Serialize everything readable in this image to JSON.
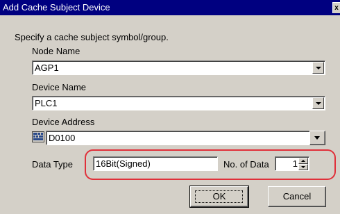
{
  "dialog": {
    "title": "Add Cache Subject Device",
    "close_glyph": "x",
    "instruction": "Specify a cache subject symbol/group."
  },
  "node": {
    "label": "Node Name",
    "value": "AGP1"
  },
  "device": {
    "label": "Device Name",
    "value": "PLC1"
  },
  "address": {
    "label": "Device Address",
    "value": "D0100",
    "icon": "device-address-input-icon"
  },
  "data_type": {
    "label": "Data Type",
    "value": "16Bit(Signed)"
  },
  "data_count": {
    "label": "No. of Data",
    "value": "1"
  },
  "buttons": {
    "ok": "OK",
    "cancel": "Cancel"
  },
  "colors": {
    "titlebar": "#000080",
    "dialog_bg": "#d4d0c8",
    "highlight": "#e0303a"
  }
}
